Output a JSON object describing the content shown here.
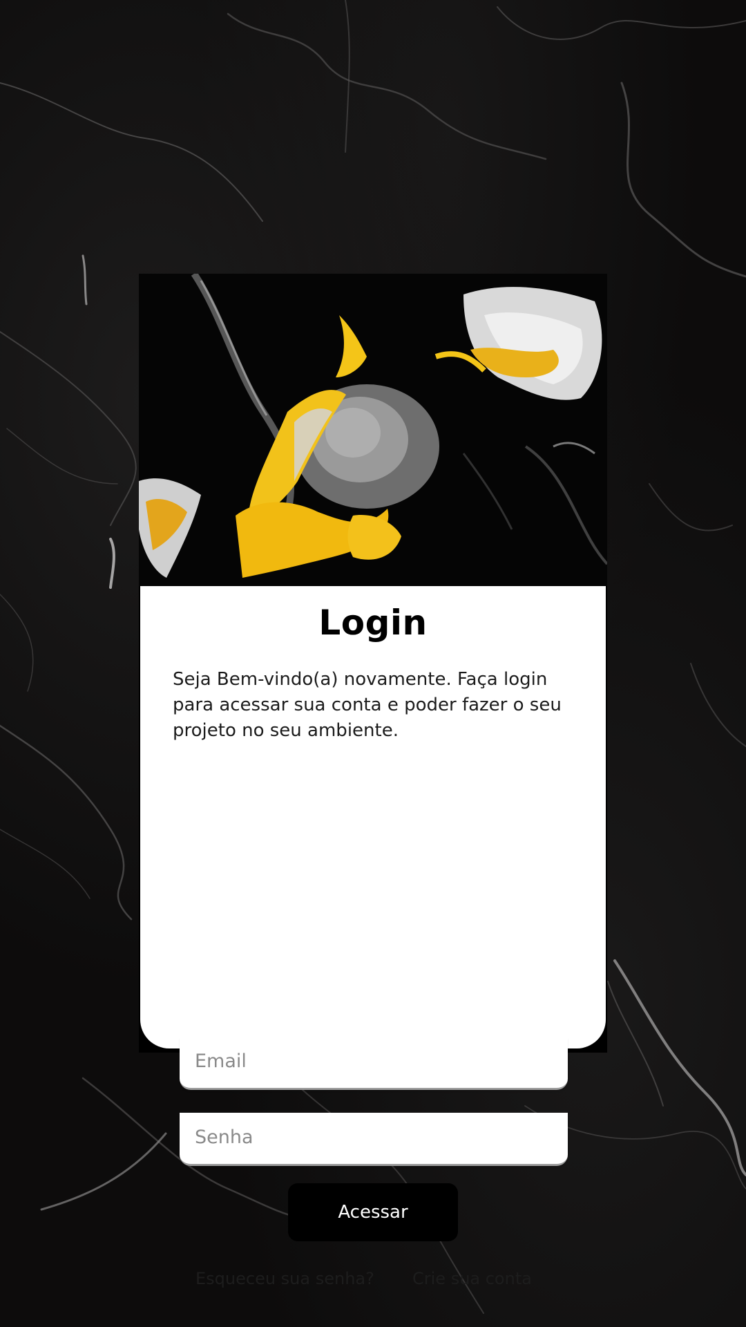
{
  "login_card": {
    "title": "Login",
    "subtitle": "Seja Bem-vindo(a) novamente. Faça login para acessar sua conta e poder fazer o seu projeto no seu ambiente.",
    "email": {
      "placeholder": "Email",
      "value": ""
    },
    "password": {
      "placeholder": "Senha",
      "value": ""
    },
    "submit_label": "Acessar",
    "forgot_password_label": "Esqueceu sua senha?",
    "create_account_label": "Crie sua conta"
  },
  "colors": {
    "background": "#0d0c0c",
    "card_surface": "#ffffff",
    "button": "#000000",
    "accent_gold": "#f2c21a"
  }
}
